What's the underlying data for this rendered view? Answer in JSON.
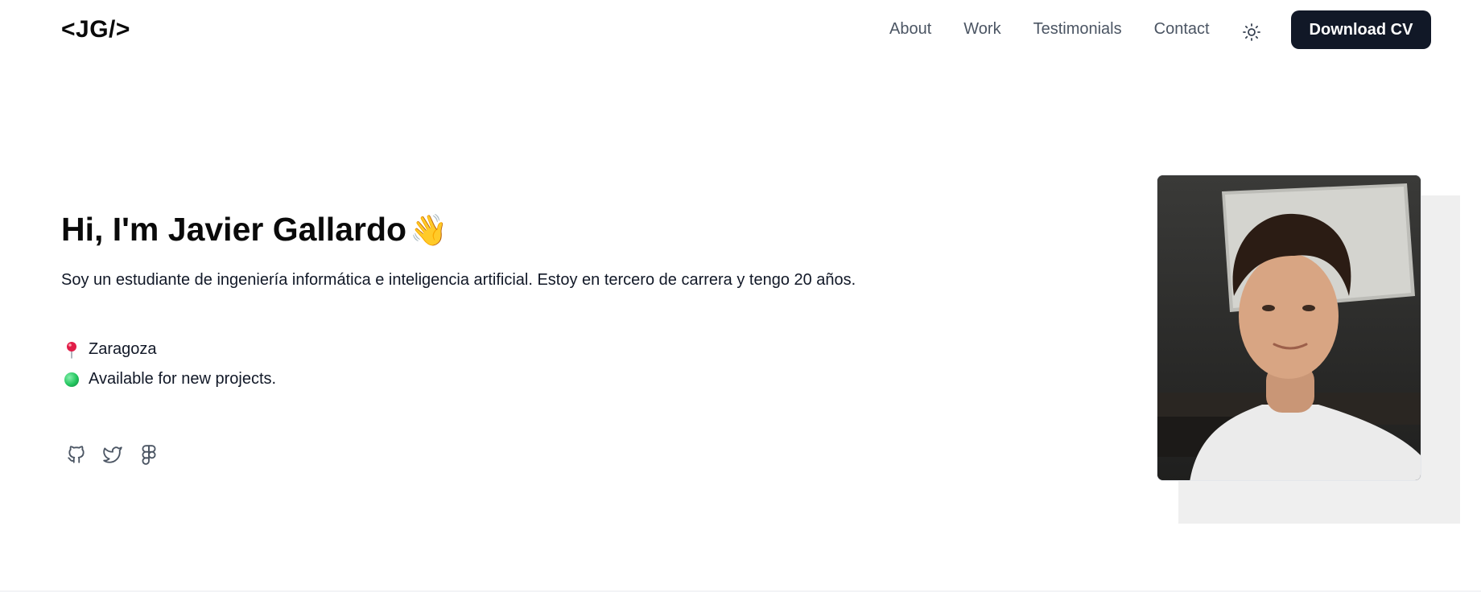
{
  "header": {
    "logo": "<JG/>",
    "nav": [
      "About",
      "Work",
      "Testimonials",
      "Contact"
    ],
    "theme_toggle_icon": "sun-icon",
    "cv_button": "Download CV"
  },
  "hero": {
    "title": "Hi, I'm Javier Gallardo",
    "title_emoji": "👋",
    "bio": "Soy un estudiante de ingeniería informática e inteligencia artificial. Estoy en tercero de carrera y tengo 20 años.",
    "location_icon": "pin-icon",
    "location": "Zaragoza",
    "status_icon": "green-dot-icon",
    "status": "Available for new projects.",
    "socials": [
      "github-icon",
      "twitter-icon",
      "figma-icon"
    ]
  },
  "colors": {
    "primary": "#111827",
    "nav_text": "#4b5563",
    "accent_green": "#22c55e",
    "pin_red": "#e11d48",
    "photo_shadow": "#efefef"
  }
}
